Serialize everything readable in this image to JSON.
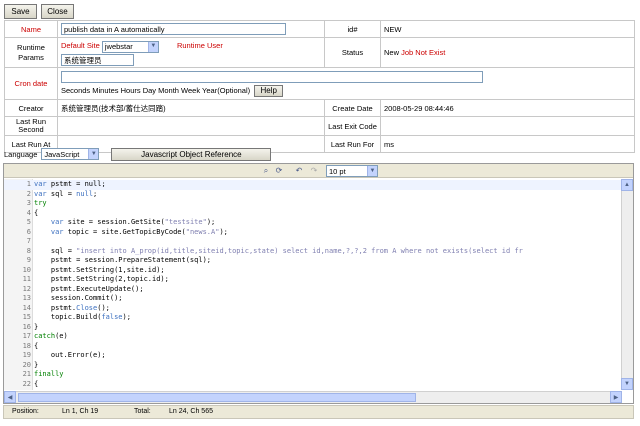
{
  "toolbar": {
    "save_label": "Save",
    "close_label": "Close"
  },
  "form": {
    "name_label": "Name",
    "name_value": "publish data in A automatically",
    "id_label": "id#",
    "id_value": "NEW",
    "runtime_params_label": "Runtime Params",
    "default_site_label": "Default Site",
    "site_value": "jwebstar",
    "runtime_user_label": "Runtime User",
    "runtime_user_value": "系统管理员",
    "status_label": "Status",
    "status_value": "New",
    "status_note": "Job Not Exist",
    "cron_label": "Cron date",
    "cron_value": "",
    "cron_hint": "Seconds Minutes Hours Day Month Week Year(Optional)",
    "help_label": "Help",
    "creator_label": "Creator",
    "creator_value": "系统管理员(技术部/蓄仕达同踏)",
    "create_date_label": "Create Date",
    "create_date_value": "2008-05-29 08:44:46",
    "last_run_second_label": "Last Run Second",
    "last_run_second_value": "",
    "last_exit_code_label": "Last Exit Code",
    "last_exit_code_value": "",
    "last_run_at_label": "Last Run At",
    "last_run_at_value": "",
    "last_run_for_label": "Last Run For",
    "last_run_for_value": "ms"
  },
  "language": {
    "label": "Language",
    "value": "JavaScript",
    "reference_button": "Javascript Object Reference"
  },
  "editor": {
    "font_size": "10 pt",
    "icons": [
      "search-icon",
      "replace-icon",
      "undo-icon",
      "redo-icon"
    ],
    "lines": [
      {
        "n": "1",
        "parts": [
          {
            "t": "var",
            "c": "kw2"
          },
          {
            "t": " pstmt = null;",
            "c": ""
          }
        ]
      },
      {
        "n": "2",
        "parts": [
          {
            "t": "var",
            "c": "kw2"
          },
          {
            "t": " sql = ",
            "c": ""
          },
          {
            "t": "null",
            "c": "kw2"
          },
          {
            "t": ";",
            "c": ""
          }
        ]
      },
      {
        "n": "3",
        "parts": [
          {
            "t": "try",
            "c": "kw"
          }
        ]
      },
      {
        "n": "4",
        "parts": [
          {
            "t": "{",
            "c": ""
          }
        ]
      },
      {
        "n": "5",
        "parts": [
          {
            "t": "    ",
            "c": ""
          },
          {
            "t": "var",
            "c": "kw2"
          },
          {
            "t": " site = session.GetSite(",
            "c": ""
          },
          {
            "t": "\"testsite\"",
            "c": "str"
          },
          {
            "t": ");",
            "c": ""
          }
        ]
      },
      {
        "n": "6",
        "parts": [
          {
            "t": "    ",
            "c": ""
          },
          {
            "t": "var",
            "c": "kw2"
          },
          {
            "t": " topic = site.GetTopicByCode(",
            "c": ""
          },
          {
            "t": "\"news.A\"",
            "c": "str"
          },
          {
            "t": ");",
            "c": ""
          }
        ]
      },
      {
        "n": "7",
        "parts": [
          {
            "t": "",
            "c": ""
          }
        ]
      },
      {
        "n": "8",
        "parts": [
          {
            "t": "    sql = ",
            "c": ""
          },
          {
            "t": "\"insert into A_prop(id,title,siteid,topic,state) select id,name,?,?,2 from A where not exists(select id fr",
            "c": "str"
          }
        ]
      },
      {
        "n": "9",
        "parts": [
          {
            "t": "    pstmt = session.PrepareStatement(sql);",
            "c": ""
          }
        ]
      },
      {
        "n": "10",
        "parts": [
          {
            "t": "    pstmt.SetString(1,site.id);",
            "c": ""
          }
        ]
      },
      {
        "n": "11",
        "parts": [
          {
            "t": "    pstmt.SetString(2,topic.id);",
            "c": ""
          }
        ]
      },
      {
        "n": "12",
        "parts": [
          {
            "t": "    pstmt.ExecuteUpdate();",
            "c": ""
          }
        ]
      },
      {
        "n": "13",
        "parts": [
          {
            "t": "    session.Commit();",
            "c": ""
          }
        ]
      },
      {
        "n": "14",
        "parts": [
          {
            "t": "    pstmt.",
            "c": ""
          },
          {
            "t": "Close",
            "c": "kw2"
          },
          {
            "t": "();",
            "c": ""
          }
        ]
      },
      {
        "n": "15",
        "parts": [
          {
            "t": "    topic.Build(",
            "c": ""
          },
          {
            "t": "false",
            "c": "kw2"
          },
          {
            "t": ");",
            "c": ""
          }
        ]
      },
      {
        "n": "16",
        "parts": [
          {
            "t": "}",
            "c": ""
          }
        ]
      },
      {
        "n": "17",
        "parts": [
          {
            "t": "catch",
            "c": "kw"
          },
          {
            "t": "(e)",
            "c": ""
          }
        ]
      },
      {
        "n": "18",
        "parts": [
          {
            "t": "{",
            "c": ""
          }
        ]
      },
      {
        "n": "19",
        "parts": [
          {
            "t": "    out.Error(e);",
            "c": ""
          }
        ]
      },
      {
        "n": "20",
        "parts": [
          {
            "t": "}",
            "c": ""
          }
        ]
      },
      {
        "n": "21",
        "parts": [
          {
            "t": "finally",
            "c": "kw"
          }
        ]
      },
      {
        "n": "22",
        "parts": [
          {
            "t": "{",
            "c": ""
          }
        ]
      }
    ]
  },
  "status": {
    "position_label": "Position:",
    "position_value": "Ln 1, Ch 19",
    "total_label": "Total:",
    "total_value": "Ln 24, Ch 565"
  }
}
